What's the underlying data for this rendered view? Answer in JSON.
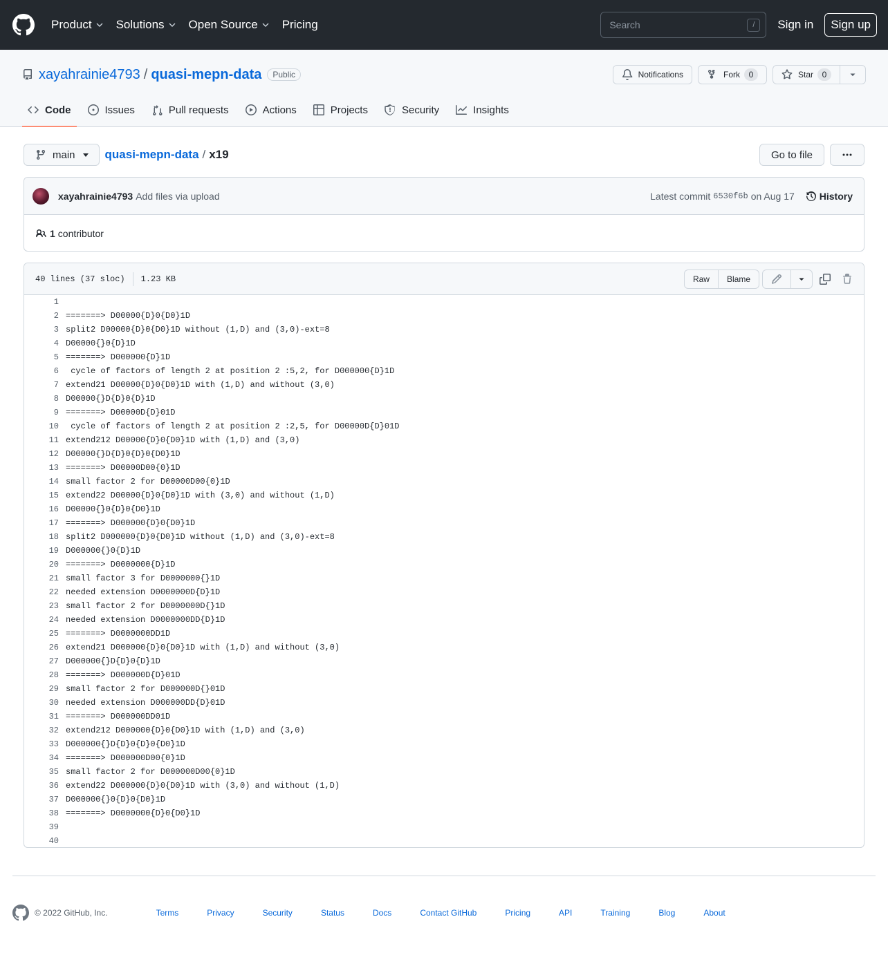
{
  "header": {
    "nav": [
      "Product",
      "Solutions",
      "Open Source",
      "Pricing"
    ],
    "search_placeholder": "Search",
    "search_shortcut": "/",
    "sign_in": "Sign in",
    "sign_up": "Sign up"
  },
  "repo": {
    "owner": "xayahrainie4793",
    "separator": "/",
    "name": "quasi-mepn-data",
    "visibility": "Public",
    "notifications_label": "Notifications",
    "fork_label": "Fork",
    "fork_count": "0",
    "star_label": "Star",
    "star_count": "0"
  },
  "tabs": [
    {
      "label": "Code",
      "icon": "code-icon"
    },
    {
      "label": "Issues",
      "icon": "issue-icon"
    },
    {
      "label": "Pull requests",
      "icon": "pull-request-icon"
    },
    {
      "label": "Actions",
      "icon": "play-icon"
    },
    {
      "label": "Projects",
      "icon": "table-icon"
    },
    {
      "label": "Security",
      "icon": "shield-icon"
    },
    {
      "label": "Insights",
      "icon": "graph-icon"
    }
  ],
  "file_nav": {
    "branch": "main",
    "repo_link": "quasi-mepn-data",
    "separator": "/",
    "file_name": "x19",
    "go_to_file": "Go to file"
  },
  "commit": {
    "author": "xayahrainie4793",
    "message": "Add files via upload",
    "latest_prefix": "Latest commit",
    "sha": "6530f6b",
    "date": "on Aug 17",
    "history": "History",
    "contributors_count": "1",
    "contributors_label": "contributor"
  },
  "file": {
    "lines_info": "40 lines (37 sloc)",
    "size": "1.23 KB",
    "raw": "Raw",
    "blame": "Blame",
    "lines": [
      "",
      "=======> D00000{D}0{D0}1D",
      "split2 D00000{D}0{D0}1D without (1,D) and (3,0)-ext=8",
      "D00000{}0{D}1D",
      "=======> D000000{D}1D",
      " cycle of factors of length 2 at position 2 :5,2, for D000000{D}1D",
      "extend21 D00000{D}0{D0}1D with (1,D) and without (3,0)",
      "D00000{}D{D}0{D}1D",
      "=======> D00000D{D}01D",
      " cycle of factors of length 2 at position 2 :2,5, for D00000D{D}01D",
      "extend212 D00000{D}0{D0}1D with (1,D) and (3,0)",
      "D00000{}D{D}0{D}0{D0}1D",
      "=======> D00000D00{0}1D",
      "small factor 2 for D00000D00{0}1D",
      "extend22 D00000{D}0{D0}1D with (3,0) and without (1,D)",
      "D00000{}0{D}0{D0}1D",
      "=======> D000000{D}0{D0}1D",
      "split2 D000000{D}0{D0}1D without (1,D) and (3,0)-ext=8",
      "D000000{}0{D}1D",
      "=======> D0000000{D}1D",
      "small factor 3 for D0000000{}1D",
      "needed extension D0000000D{D}1D",
      "small factor 2 for D0000000D{}1D",
      "needed extension D0000000DD{D}1D",
      "=======> D0000000DD1D",
      "extend21 D000000{D}0{D0}1D with (1,D) and without (3,0)",
      "D000000{}D{D}0{D}1D",
      "=======> D000000D{D}01D",
      "small factor 2 for D000000D{}01D",
      "needed extension D000000DD{D}01D",
      "=======> D000000DD01D",
      "extend212 D000000{D}0{D0}1D with (1,D) and (3,0)",
      "D000000{}D{D}0{D}0{D0}1D",
      "=======> D000000D00{0}1D",
      "small factor 2 for D000000D00{0}1D",
      "extend22 D000000{D}0{D0}1D with (3,0) and without (1,D)",
      "D000000{}0{D}0{D0}1D",
      "=======> D0000000{D}0{D0}1D",
      "",
      ""
    ]
  },
  "footer": {
    "copyright": "© 2022 GitHub, Inc.",
    "links": [
      "Terms",
      "Privacy",
      "Security",
      "Status",
      "Docs",
      "Contact GitHub",
      "Pricing",
      "API",
      "Training",
      "Blog",
      "About"
    ]
  }
}
